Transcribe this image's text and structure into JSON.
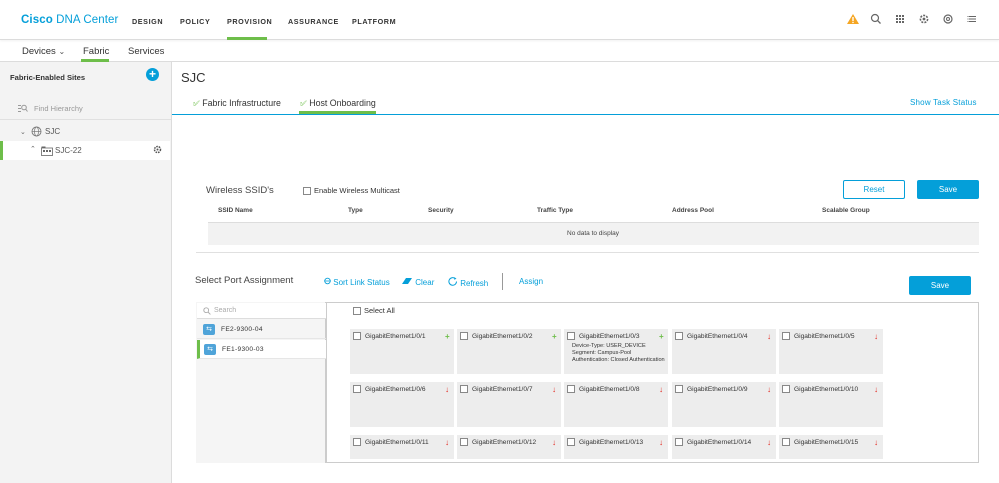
{
  "header": {
    "brand_bold": "Cisco",
    "brand_rest": " DNA Center",
    "nav": [
      "DESIGN",
      "POLICY",
      "PROVISION",
      "ASSURANCE",
      "PLATFORM"
    ],
    "active_nav": "PROVISION",
    "icons": [
      "alert-triangle-icon",
      "search-icon",
      "apps-grid-icon",
      "gear-icon",
      "settings-cog-icon",
      "menu-list-icon"
    ]
  },
  "subnav": {
    "devices": "Devices",
    "fabric": "Fabric",
    "services": "Services",
    "active": "Fabric"
  },
  "sidebar": {
    "title": "Fabric-Enabled Sites",
    "search_placeholder": "Find Hierarchy",
    "tree": [
      {
        "label": "SJC",
        "expanded": true
      },
      {
        "label": "SJC-22",
        "selected": true
      }
    ]
  },
  "main": {
    "title": "SJC",
    "tabs": [
      {
        "label": "Fabric Infrastructure",
        "active": false
      },
      {
        "label": "Host Onboarding",
        "active": true
      }
    ],
    "show_task_status": "Show Task Status"
  },
  "wireless": {
    "title": "Wireless SSID's",
    "multicast_label": "Enable Wireless Multicast",
    "reset_label": "Reset",
    "save_label": "Save",
    "columns": [
      "SSID Name",
      "Type",
      "Security",
      "Traffic Type",
      "Address Pool",
      "Scalable Group"
    ],
    "empty_text": "No data to display"
  },
  "ports": {
    "title": "Select Port Assignment",
    "sort_label": "Sort Link Status",
    "clear_label": "Clear",
    "refresh_label": "Refresh",
    "assign_label": "Assign",
    "save_label": "Save",
    "search_placeholder": "Search",
    "select_all_label": "Select All",
    "devices": [
      {
        "name": "FE2-9300-04",
        "selected": false
      },
      {
        "name": "FE1-9300-03",
        "selected": true
      }
    ],
    "interfaces": [
      {
        "name": "GigabitEthernet1/0/1",
        "status": "up"
      },
      {
        "name": "GigabitEthernet1/0/2",
        "status": "up"
      },
      {
        "name": "GigabitEthernet1/0/3",
        "status": "up",
        "details": [
          "Device-Type: USER_DEVICE",
          "Segment: Campus-Pool",
          "Authentication: Closed Authentication"
        ]
      },
      {
        "name": "GigabitEthernet1/0/4",
        "status": "down"
      },
      {
        "name": "GigabitEthernet1/0/5",
        "status": "down"
      },
      {
        "name": "GigabitEthernet1/0/6",
        "status": "down"
      },
      {
        "name": "GigabitEthernet1/0/7",
        "status": "down"
      },
      {
        "name": "GigabitEthernet1/0/8",
        "status": "down"
      },
      {
        "name": "GigabitEthernet1/0/9",
        "status": "down"
      },
      {
        "name": "GigabitEthernet1/0/10",
        "status": "down"
      },
      {
        "name": "GigabitEthernet1/0/11",
        "status": "down"
      },
      {
        "name": "GigabitEthernet1/0/12",
        "status": "down"
      },
      {
        "name": "GigabitEthernet1/0/13",
        "status": "down"
      },
      {
        "name": "GigabitEthernet1/0/14",
        "status": "down"
      },
      {
        "name": "GigabitEthernet1/0/15",
        "status": "down"
      }
    ]
  },
  "colors": {
    "accent": "#049fd9",
    "active_green": "#6ebe4a",
    "down_red": "#e2231a",
    "warning": "#f5a623"
  }
}
